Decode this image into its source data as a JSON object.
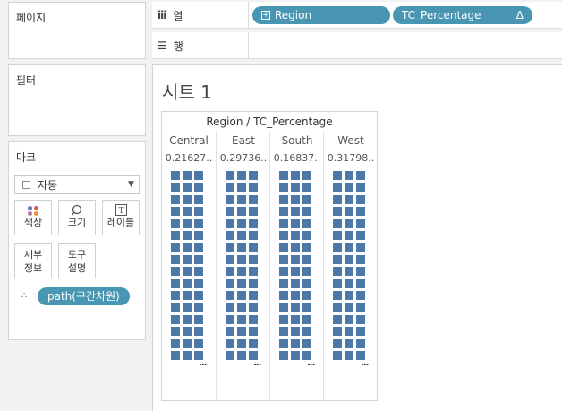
{
  "pages": {
    "title": "페이지"
  },
  "filters": {
    "title": "필터"
  },
  "marks": {
    "title": "마크",
    "mark_type": "자동",
    "buttons": [
      {
        "label": "색상",
        "icon": "color-dots-icon"
      },
      {
        "label": "크기",
        "icon": "size-icon"
      },
      {
        "label": "레이블",
        "icon": "label-icon"
      },
      {
        "label_line1": "세부",
        "label_line2": "정보",
        "icon": "detail"
      },
      {
        "label_line1": "도구",
        "label_line2": "설명",
        "icon": "tooltip"
      }
    ],
    "detail_pill": "path(구간차원)"
  },
  "columns_shelf": {
    "label": "열",
    "pills": [
      {
        "label": "Region",
        "prefix": "⊞"
      },
      {
        "label": "TC_Percentage",
        "suffix": "Δ"
      }
    ]
  },
  "rows_shelf": {
    "label": "행"
  },
  "sheet": {
    "title": "시트 1"
  },
  "chart_data": {
    "type": "table",
    "header": "Region / TC_Percentage",
    "categories": [
      "Central",
      "East",
      "South",
      "West"
    ],
    "values_text": [
      "0.21627..",
      "0.29736..",
      "0.16837..",
      "0.31798.."
    ],
    "grid_rows": 16,
    "grid_cols": 3,
    "mark_color": "#4e79a7",
    "overflow_text": "..."
  },
  "colors": {
    "pill": "#4996b2",
    "mark": "#4e79a7"
  }
}
